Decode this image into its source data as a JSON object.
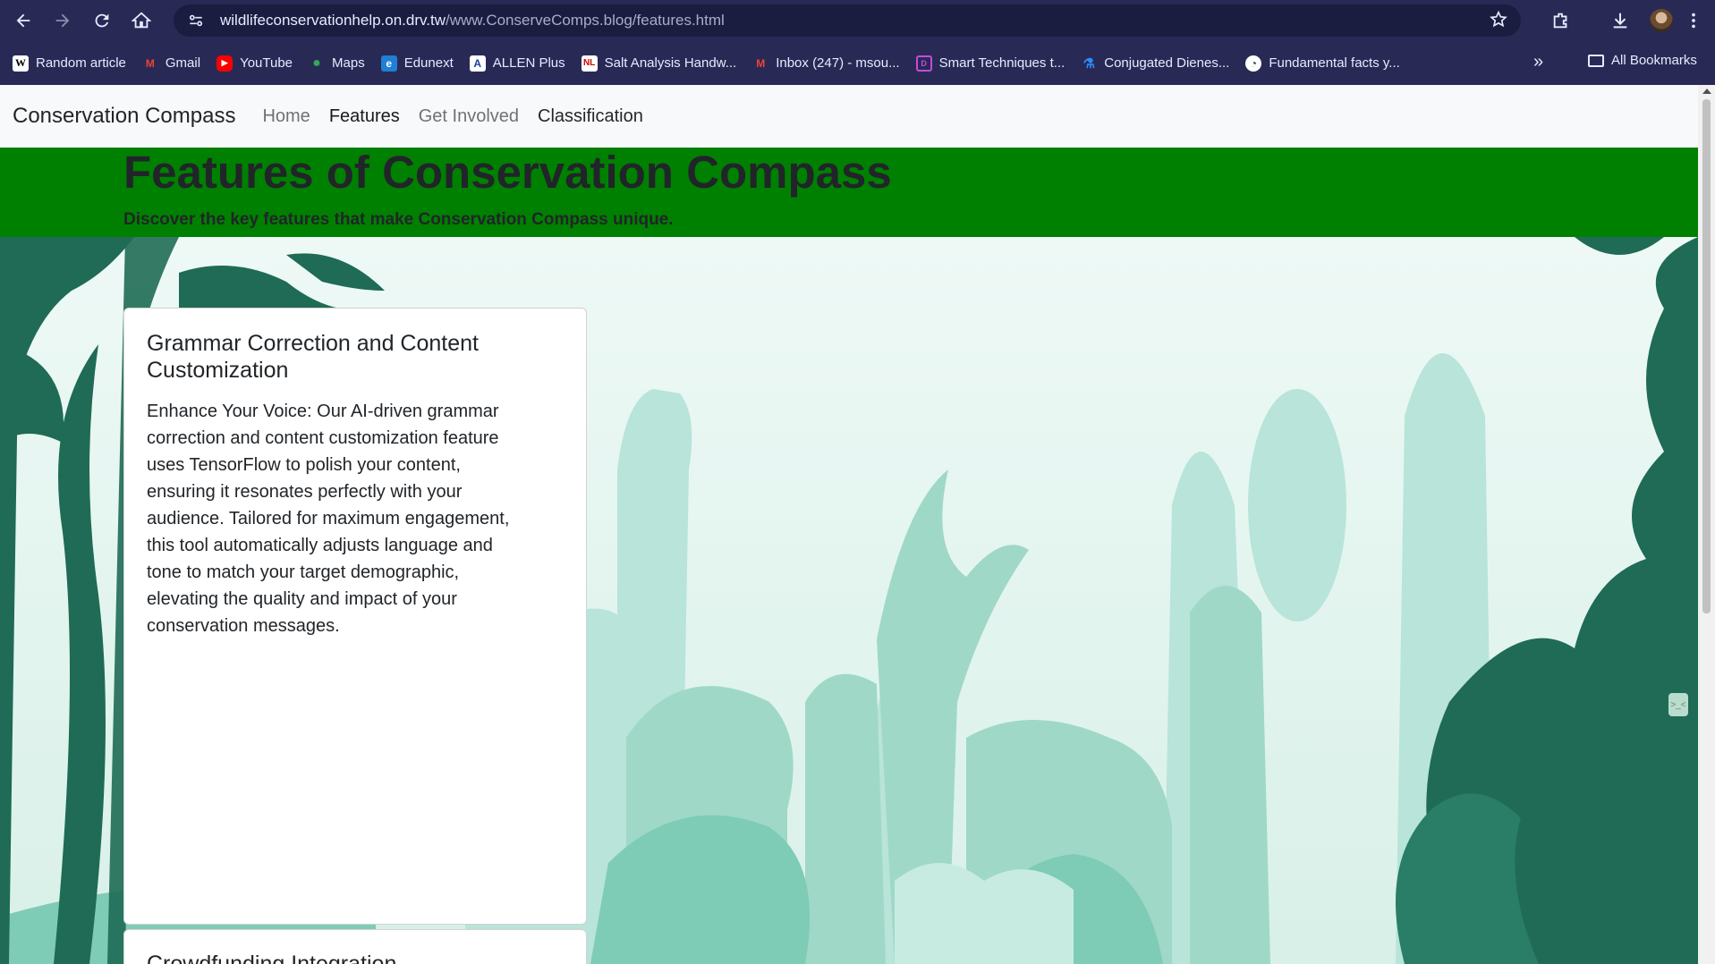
{
  "browser": {
    "url_host": "wildlifeconservationhelp.on.drv.tw",
    "url_path": "/www.ConserveComps.blog/features.html",
    "bookmarks": [
      {
        "label": "Random article",
        "icon": "wikipedia-icon"
      },
      {
        "label": "Gmail",
        "icon": "gmail-icon"
      },
      {
        "label": "YouTube",
        "icon": "youtube-icon"
      },
      {
        "label": "Maps",
        "icon": "maps-icon"
      },
      {
        "label": "Edunext",
        "icon": "edunext-icon"
      },
      {
        "label": "ALLEN Plus",
        "icon": "allen-icon"
      },
      {
        "label": "Salt Analysis Handw...",
        "icon": "nl-icon"
      },
      {
        "label": "Inbox (247) - msou...",
        "icon": "gmail-icon"
      },
      {
        "label": "Smart Techniques t...",
        "icon": "bookmark-icon"
      },
      {
        "label": "Conjugated Dienes...",
        "icon": "flask-icon"
      },
      {
        "label": "Fundamental facts y...",
        "icon": "globe-icon"
      }
    ],
    "more_label": "»",
    "all_bookmarks_label": "All Bookmarks"
  },
  "navbar": {
    "brand": "Conservation Compass",
    "links": [
      "Home",
      "Features",
      "Get Involved",
      "Classification"
    ]
  },
  "hero": {
    "title": "Features of Conservation Compass",
    "subtitle": "Discover the key features that make Conservation Compass unique."
  },
  "cards": [
    {
      "title": "Grammar Correction and Content Customization",
      "body": "Enhance Your Voice: Our AI-driven grammar correction and content customization feature uses TensorFlow to polish your content, ensuring it resonates perfectly with your audience. Tailored for maximum engagement, this tool automatically adjusts language and tone to match your target demographic, elevating the quality and impact of your conservation messages."
    },
    {
      "title": "Crowdfunding Integration"
    }
  ],
  "colors": {
    "hero_bg": "#008000",
    "chrome_bg": "#282a55",
    "foliage_dark": "#1f6b55",
    "foliage_light": "#a9ddd0"
  }
}
